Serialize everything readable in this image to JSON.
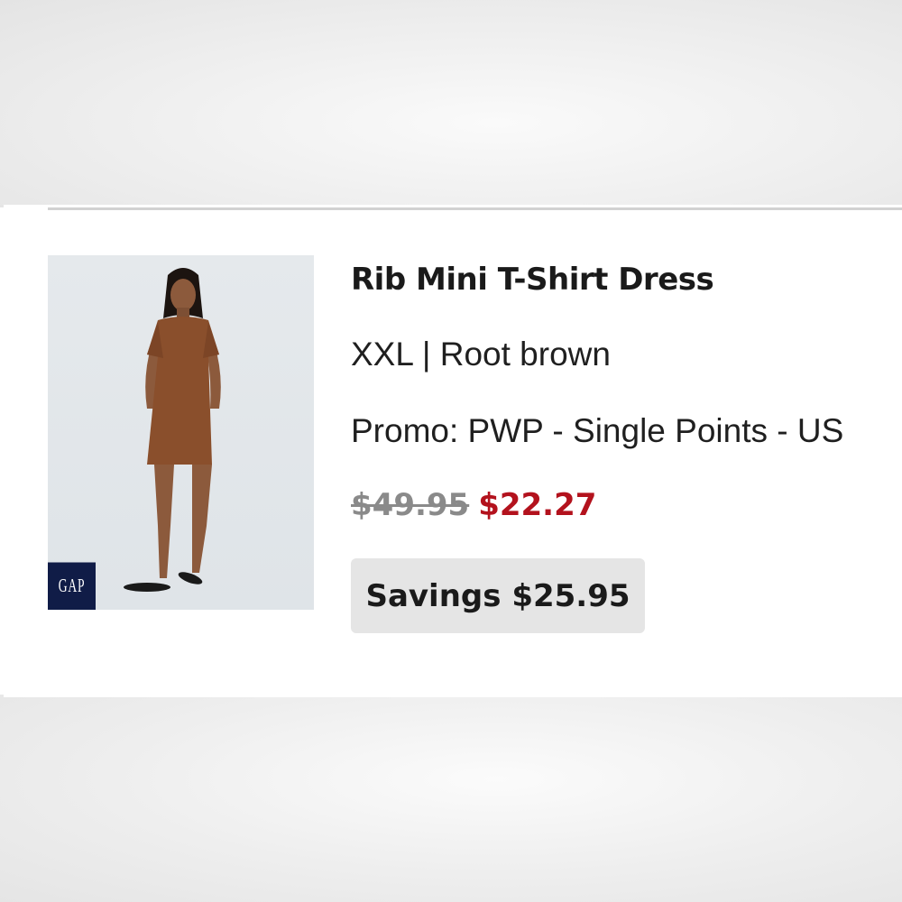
{
  "product": {
    "title": "Rib Mini T-Shirt Dress",
    "variant": "XXL | Root brown",
    "promo": "Promo: PWP - Single Points - US",
    "price_original": "$49.95",
    "price_sale": "$22.27",
    "savings": "Savings $25.95",
    "image_icon": "product-photo-dress",
    "brand_logo_text": "GAP"
  },
  "colors": {
    "sale_price": "#b3121d",
    "original_price": "#8a8a8a",
    "savings_badge_bg": "#e5e5e5",
    "brand_logo_bg": "#101c47",
    "dress": "#8a4f2c"
  }
}
